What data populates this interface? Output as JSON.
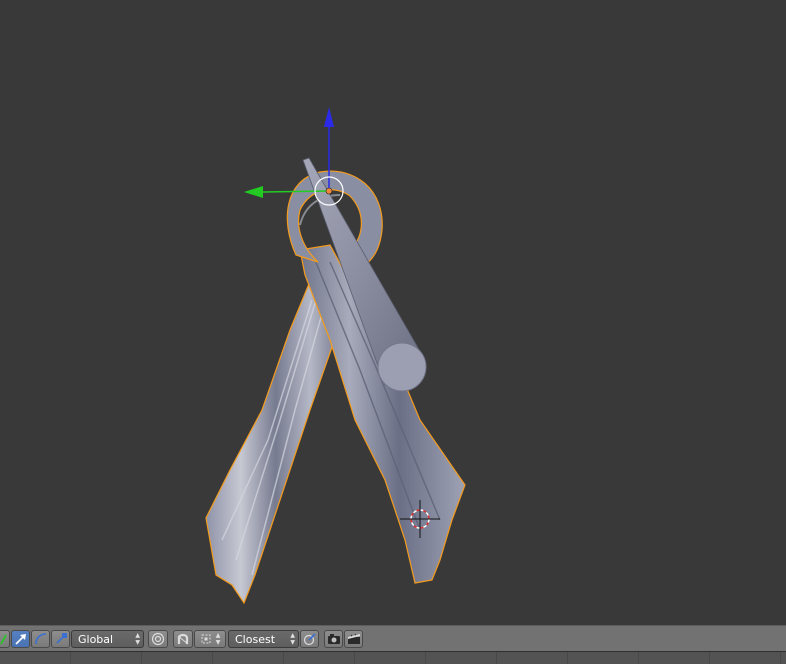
{
  "header": {
    "orientation": {
      "value": "Global"
    },
    "snap_element": {
      "value": "Closest"
    }
  },
  "icons": {
    "manipulator_translate": "translate-arrow-icon",
    "manipulator_rotate": "rotate-arc-icon",
    "manipulator_scale": "scale-arrow-icon",
    "proportional_edit": "proportional-edit-icon",
    "snap_magnet": "magnet-icon",
    "snap_target": "snap-target-icon",
    "render_still": "camera-icon",
    "render_anim": "clapper-icon"
  },
  "colors": {
    "viewport_bg": "#393939",
    "header_bg": "#727272",
    "selection_outline": "#f49b1d",
    "axis_z": "#2020e0",
    "axis_y": "#22cc22"
  }
}
